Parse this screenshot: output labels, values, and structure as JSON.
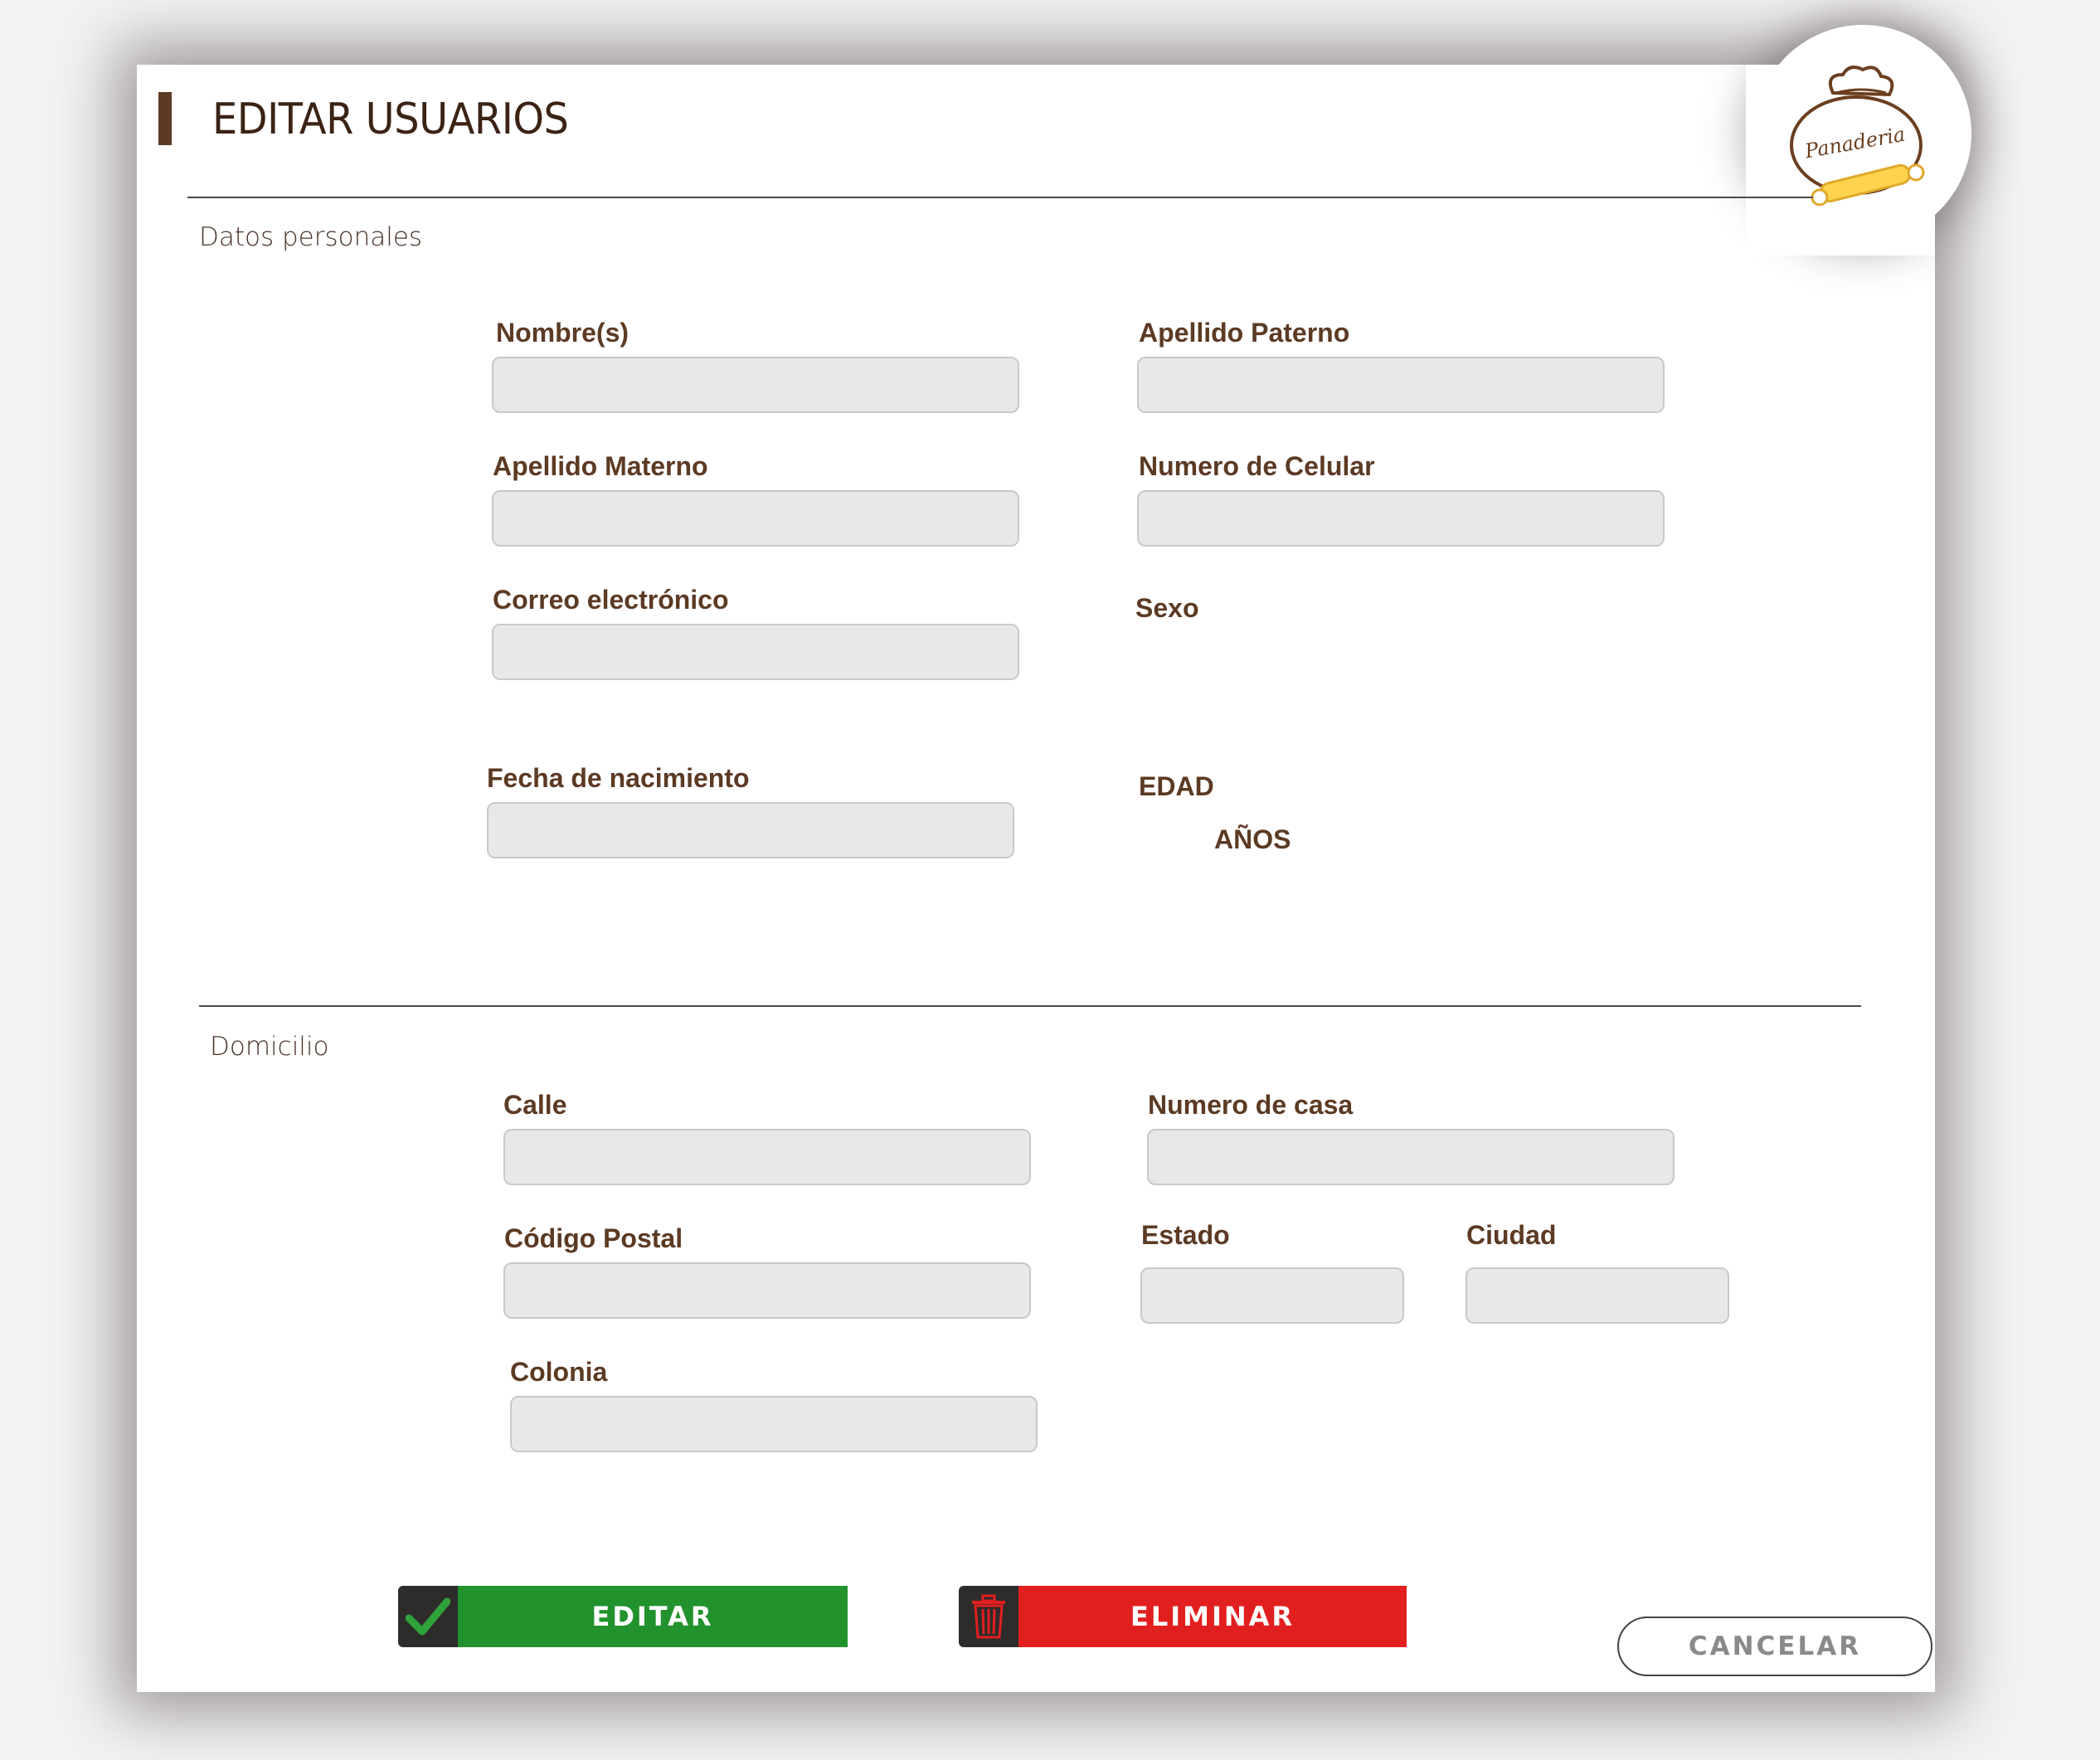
{
  "header": {
    "title": "EDITAR USUARIOS",
    "logo_text": "Panaderia"
  },
  "personal": {
    "section_title": "Datos personales",
    "nombre_label": "Nombre(s)",
    "apellido_paterno_label": "Apellido Paterno",
    "apellido_materno_label": "Apellido Materno",
    "celular_label": "Numero de Celular",
    "correo_label": "Correo electrónico",
    "sexo_label": "Sexo",
    "fecha_label": "Fecha de nacimiento",
    "edad_label": "EDAD",
    "anos_label": "AÑOS"
  },
  "domicilio": {
    "section_title": "Domicilio",
    "calle_label": "Calle",
    "numero_casa_label": "Numero de casa",
    "cp_label": "Código Postal",
    "estado_label": "Estado",
    "ciudad_label": "Ciudad",
    "colonia_label": "Colonia"
  },
  "actions": {
    "edit_label": "EDITAR",
    "delete_label": "ELIMINAR",
    "cancel_label": "CANCELAR"
  },
  "colors": {
    "edit": "#22922d",
    "delete": "#e21f1f",
    "label": "#5c3a23",
    "field_bg": "#e8e8e8"
  },
  "icons": {
    "edit": "checkmark-icon",
    "delete": "trash-icon"
  }
}
